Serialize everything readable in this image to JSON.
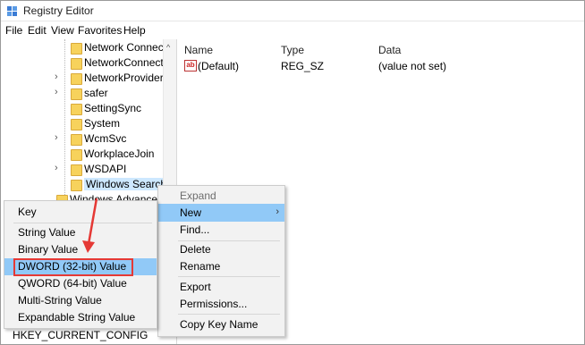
{
  "window": {
    "title": "Registry Editor"
  },
  "menu": [
    "File",
    "Edit",
    "View",
    "Favorites",
    "Help"
  ],
  "tree": {
    "items": [
      {
        "label": "Network Connectio",
        "expandable": false
      },
      {
        "label": "NetworkConnectiv",
        "expandable": false
      },
      {
        "label": "NetworkProvider",
        "expandable": true
      },
      {
        "label": "safer",
        "expandable": true
      },
      {
        "label": "SettingSync",
        "expandable": false
      },
      {
        "label": "System",
        "expandable": false
      },
      {
        "label": "WcmSvc",
        "expandable": true
      },
      {
        "label": "WorkplaceJoin",
        "expandable": false
      },
      {
        "label": "WSDAPI",
        "expandable": true
      },
      {
        "label": "Windows Search",
        "expandable": false,
        "selected": true
      },
      {
        "label": "Windows Advanced",
        "expandable": false
      }
    ],
    "status_key": "HKEY_CURRENT_CONFIG"
  },
  "values_pane": {
    "headers": {
      "name": "Name",
      "type": "Type",
      "data": "Data"
    },
    "rows": [
      {
        "icon": "ab",
        "name": "(Default)",
        "type": "REG_SZ",
        "data": "(value not set)"
      }
    ]
  },
  "context_menu": {
    "items": [
      {
        "label": "Expand",
        "disabled": true
      },
      {
        "label": "New",
        "submenu": true,
        "highlighted": true
      },
      {
        "label": "Find..."
      },
      {
        "label": "Delete"
      },
      {
        "label": "Rename"
      },
      {
        "label": "Export"
      },
      {
        "label": "Permissions..."
      },
      {
        "label": "Copy Key Name"
      }
    ]
  },
  "new_submenu": {
    "items": [
      {
        "label": "Key"
      },
      {
        "label": "String Value"
      },
      {
        "label": "Binary Value"
      },
      {
        "label": "DWORD (32-bit) Value",
        "highlighted": true
      },
      {
        "label": "QWORD (64-bit) Value"
      },
      {
        "label": "Multi-String Value"
      },
      {
        "label": "Expandable String Value"
      }
    ]
  },
  "colors": {
    "highlight": "#91c9f7",
    "annotation": "#e53935",
    "folder": "#f7d25c"
  }
}
